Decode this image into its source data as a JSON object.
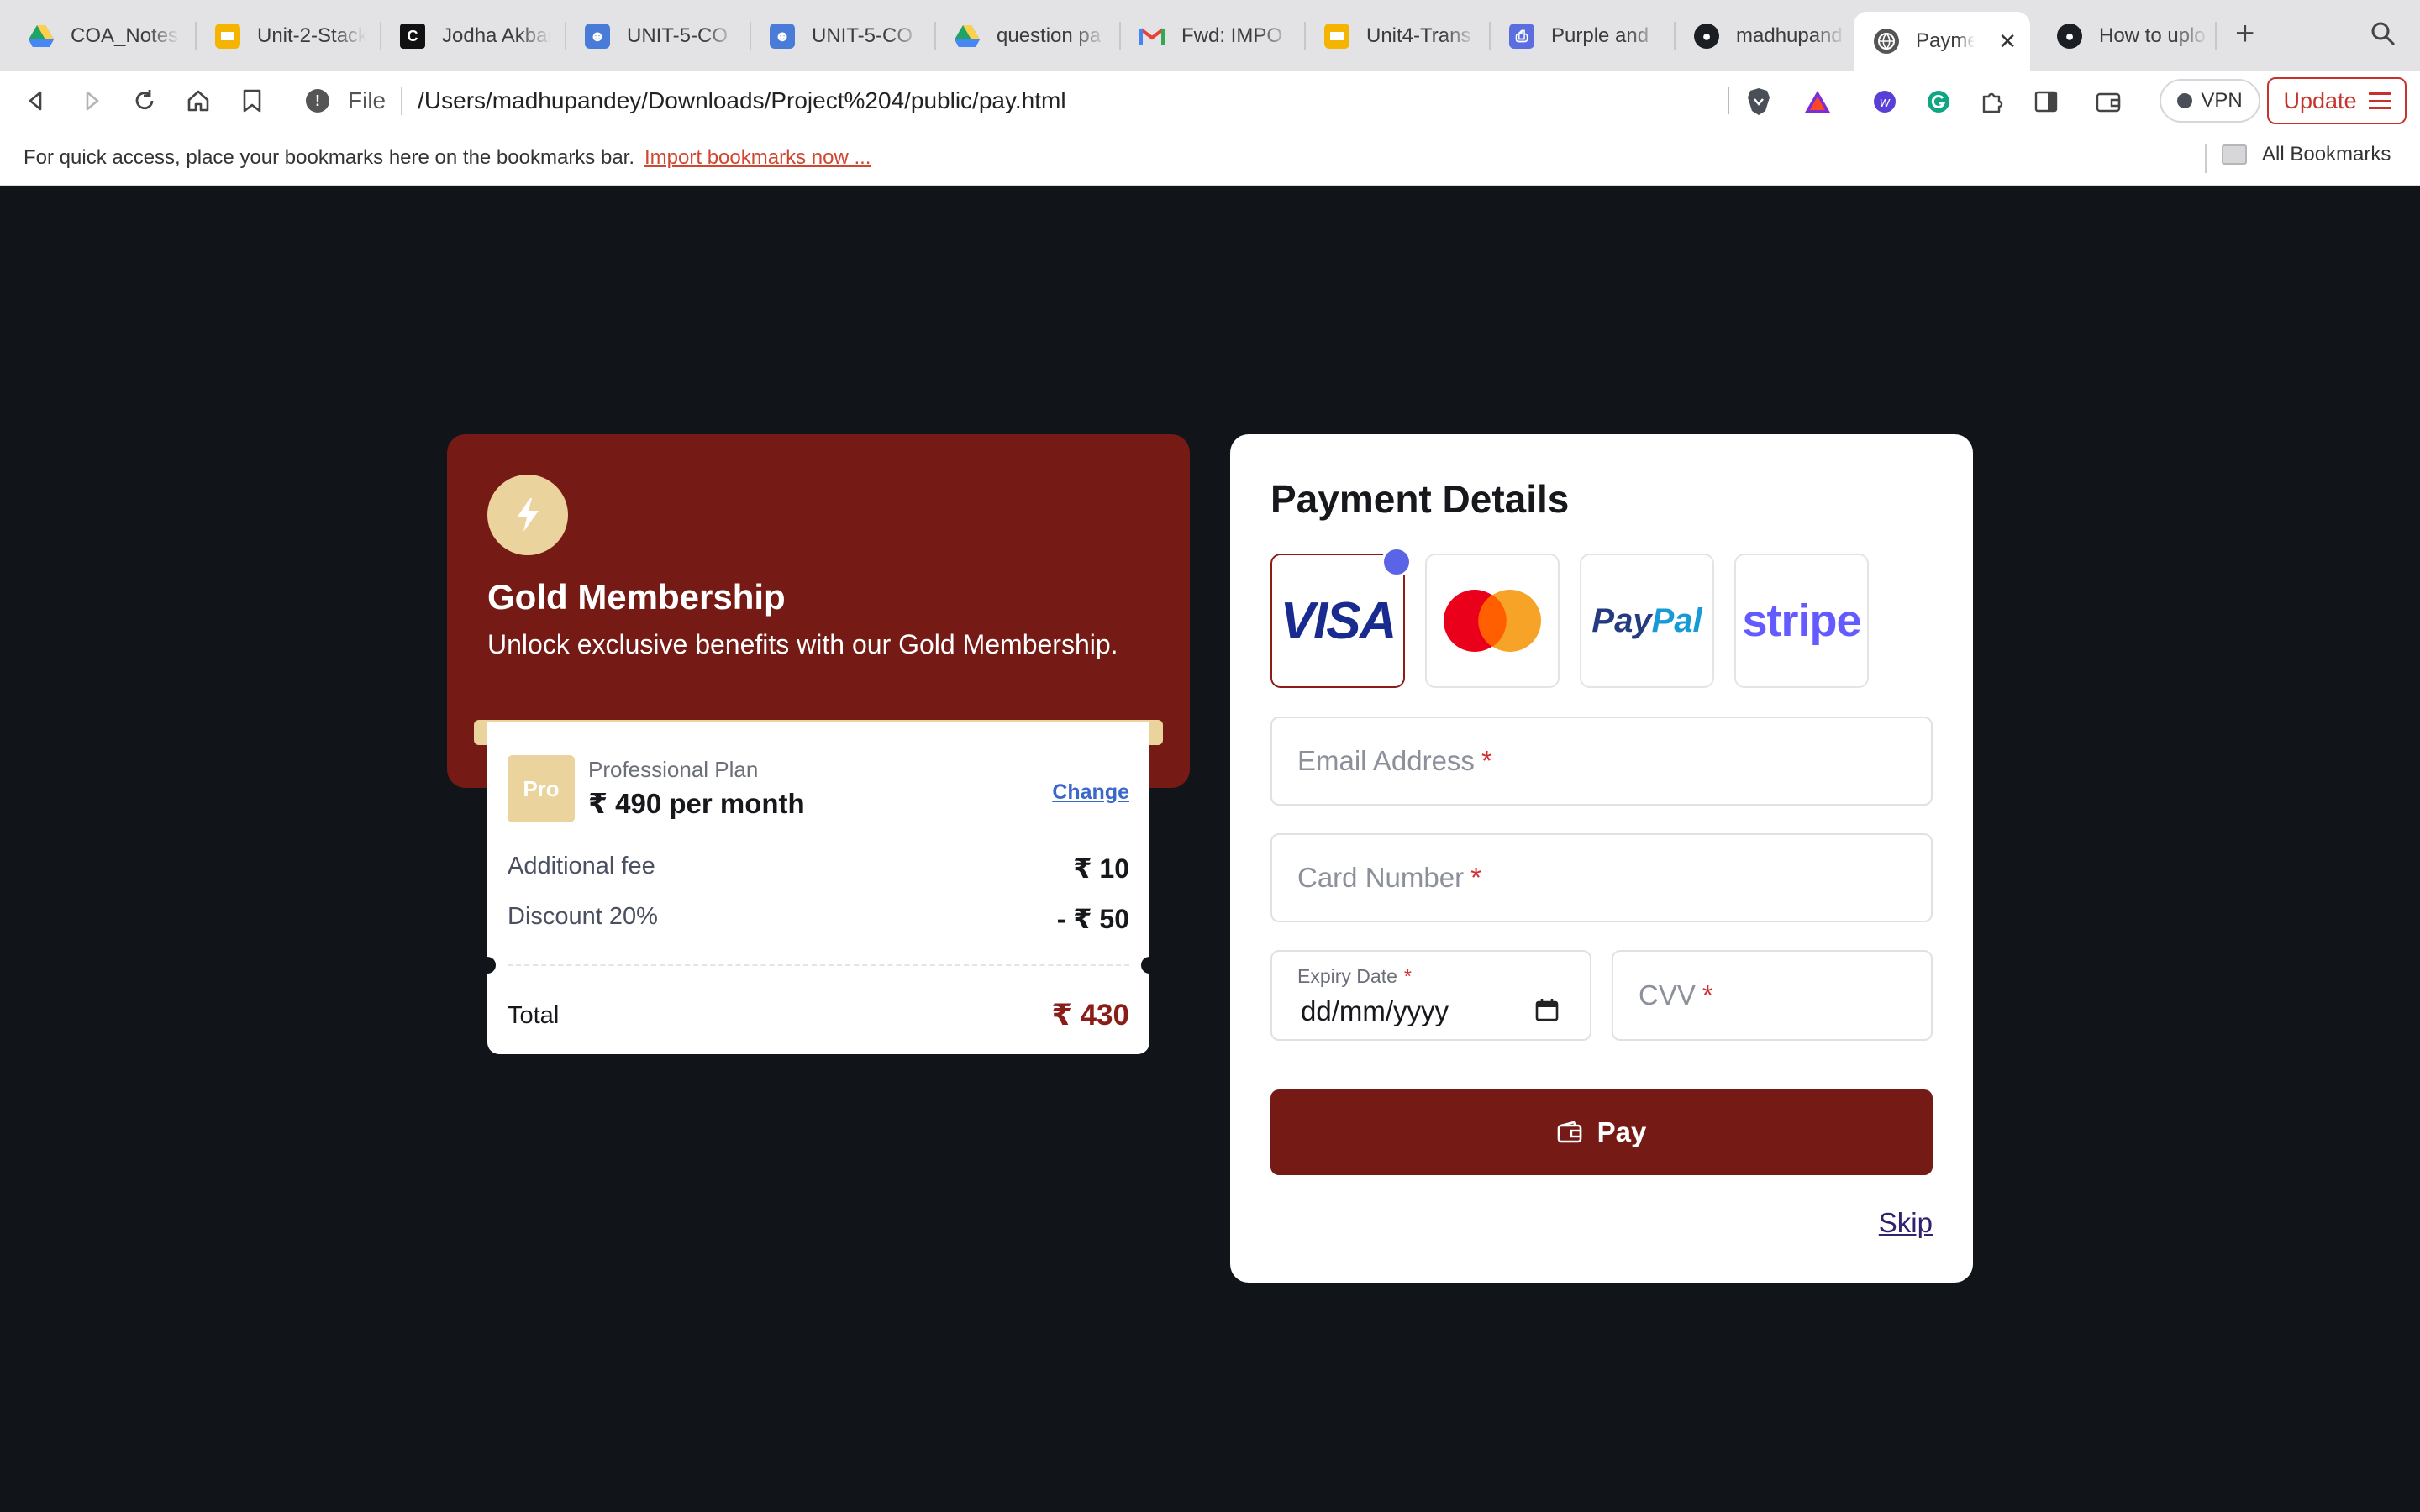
{
  "browser": {
    "tabs": [
      {
        "label": "COA_Notes",
        "icon": "google-drive-icon"
      },
      {
        "label": "Unit-2-Stack",
        "icon": "slides-icon"
      },
      {
        "label": "Jodha Akbar",
        "icon": "site-icon"
      },
      {
        "label": "UNIT-5-CO",
        "icon": "classroom-icon"
      },
      {
        "label": "UNIT-5-CO",
        "icon": "classroom-icon"
      },
      {
        "label": "question pa",
        "icon": "google-drive-icon"
      },
      {
        "label": "Fwd: IMPO",
        "icon": "gmail-icon"
      },
      {
        "label": "Unit4-Trans",
        "icon": "slides-icon"
      },
      {
        "label": "Purple and",
        "icon": "printer-icon"
      },
      {
        "label": "madhupand",
        "icon": "github-icon"
      },
      {
        "label": "Payme",
        "icon": "globe-icon",
        "active": true
      },
      {
        "label": "How to uplo",
        "icon": "github-icon"
      }
    ],
    "address": {
      "scheme": "File",
      "url": "/Users/madhupandey/Downloads/Project%204/public/pay.html"
    },
    "vpn_label": "VPN",
    "update_label": "Update",
    "bookmarks": {
      "hint": "For quick access, place your bookmarks here on the bookmarks bar.",
      "import_link": "Import bookmarks now ...",
      "all_label": "All Bookmarks"
    }
  },
  "membership": {
    "title": "Gold Membership",
    "subtitle": "Unlock exclusive benefits with our Gold Membership.",
    "plan": {
      "badge": "Pro",
      "name": "Professional Plan",
      "price": "₹ 490 per month",
      "change_label": "Change"
    },
    "fees": [
      {
        "label": "Additional fee",
        "value": "₹ 10"
      },
      {
        "label": "Discount 20%",
        "value": "- ₹ 50"
      }
    ],
    "total": {
      "label": "Total",
      "value": "₹ 430"
    }
  },
  "payment": {
    "title": "Payment Details",
    "methods": [
      {
        "name": "VISA",
        "selected": true
      },
      {
        "name": "Mastercard",
        "selected": false
      },
      {
        "name": "PayPal",
        "selected": false
      },
      {
        "name": "stripe",
        "selected": false
      }
    ],
    "email_placeholder": "Email Address",
    "card_placeholder": "Card Number",
    "expiry_label": "Expiry Date",
    "expiry_value": "dd/mm/yyyy",
    "cvv_placeholder": "CVV",
    "required_mark": "*",
    "pay_label": "Pay",
    "skip_label": "Skip"
  },
  "colors": {
    "maroon": "#761a15",
    "gold": "#ead39c",
    "page_bg": "#111418",
    "accent_dot": "#5b63e6"
  }
}
